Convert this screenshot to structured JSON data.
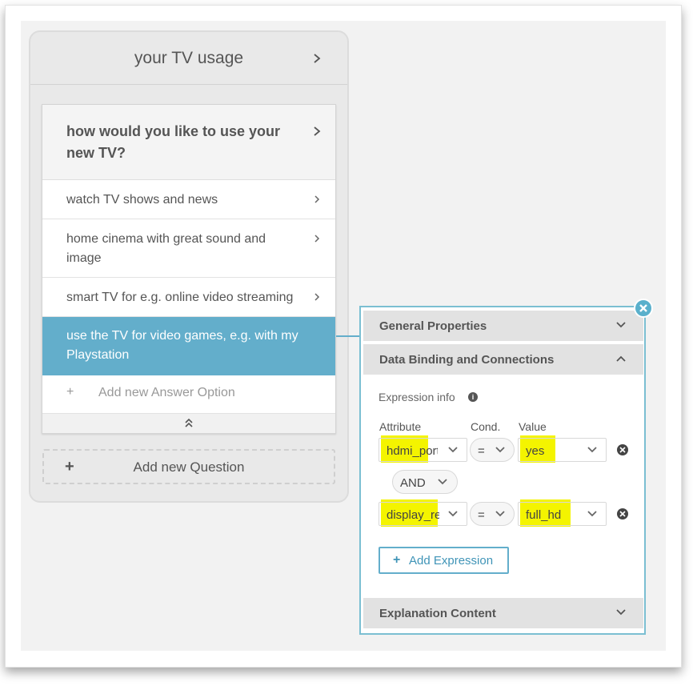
{
  "section": {
    "title": "your TV usage"
  },
  "question": {
    "title": "how would you like to use your new TV?"
  },
  "answers": [
    {
      "label": "watch TV shows and news"
    },
    {
      "label": "home cinema with great sound and image"
    },
    {
      "label": "smart TV for e.g. online video streaming"
    },
    {
      "label": "use the TV for video games, e.g. with my Playstation"
    }
  ],
  "add_answer": {
    "plus": "+",
    "label": "Add new Answer Option"
  },
  "add_question": {
    "plus": "+",
    "label": "Add new Question"
  },
  "panel": {
    "general_properties": "General Properties",
    "data_binding": "Data Binding and Connections",
    "explanation_content": "Explanation Content",
    "expression_info": "Expression info",
    "info_icon": "i",
    "col_attribute": "Attribute",
    "col_cond": "Cond.",
    "col_value": "Value",
    "rows": [
      {
        "attribute": "hdmi_ports",
        "cond": "=",
        "value": "yes"
      },
      {
        "attribute": "display_resolution",
        "cond": "=",
        "value": "full_hd"
      }
    ],
    "operator": "AND",
    "add_expression_plus": "+",
    "add_expression": "Add Expression"
  },
  "colors": {
    "accent": "#63aecb",
    "highlight": "#f4f400"
  }
}
